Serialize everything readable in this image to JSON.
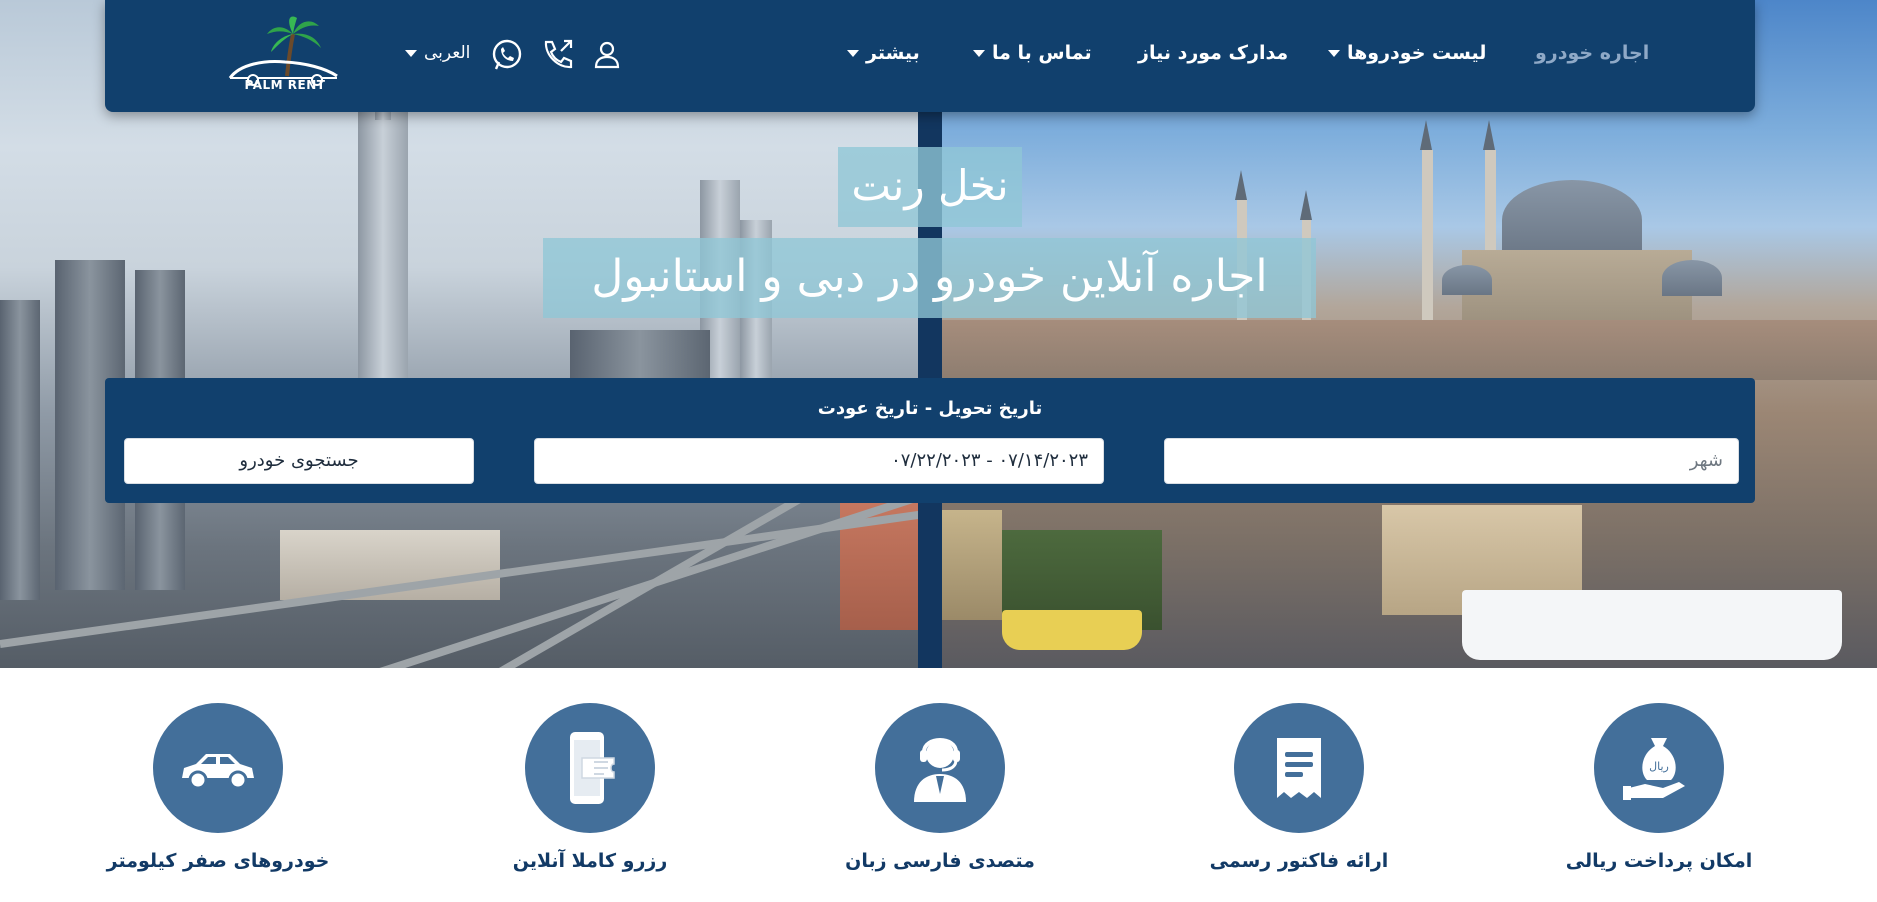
{
  "brand": {
    "logo_text": "PALM RENT"
  },
  "nav": {
    "items": [
      {
        "label": "اجاره خودرو",
        "active": true,
        "dropdown": false
      },
      {
        "label": "لیست خودروها",
        "active": false,
        "dropdown": true
      },
      {
        "label": "مدارک مورد نیاز",
        "active": false,
        "dropdown": false
      },
      {
        "label": "تماس با ما",
        "active": false,
        "dropdown": true
      },
      {
        "label": "بیشتر",
        "active": false,
        "dropdown": true
      }
    ],
    "language": "العربی",
    "icons": [
      "user-icon",
      "phone-icon",
      "whatsapp-icon"
    ]
  },
  "hero": {
    "title": "نخل رنت",
    "subtitle": "اجاره آنلاین خودرو در دبی و استانبول"
  },
  "search": {
    "label": "تاریخ تحویل - تاریخ عودت",
    "city_placeholder": "شهر",
    "date_range": "۰۷/۱۴/۲۰۲۳ - ۰۷/۲۲/۲۰۲۳",
    "button_label": "جستجوی خودرو"
  },
  "features": [
    {
      "label": "امکان پرداخت ریالی",
      "icon": "money-bag-icon",
      "icon_text": "ریال"
    },
    {
      "label": "ارائه فاکتور رسمی",
      "icon": "invoice-icon"
    },
    {
      "label": "متصدی فارسی زبان",
      "icon": "support-agent-icon"
    },
    {
      "label": "رزرو کاملا آنلاین",
      "icon": "mobile-ticket-icon"
    },
    {
      "label": "خودروهای صفر کیلومتر",
      "icon": "car-icon"
    }
  ],
  "colors": {
    "navy": "#11406d",
    "feature_circle": "#436f9a",
    "hero_text_bg": "#8fc6d6",
    "active_nav": "#8fa9c7"
  }
}
